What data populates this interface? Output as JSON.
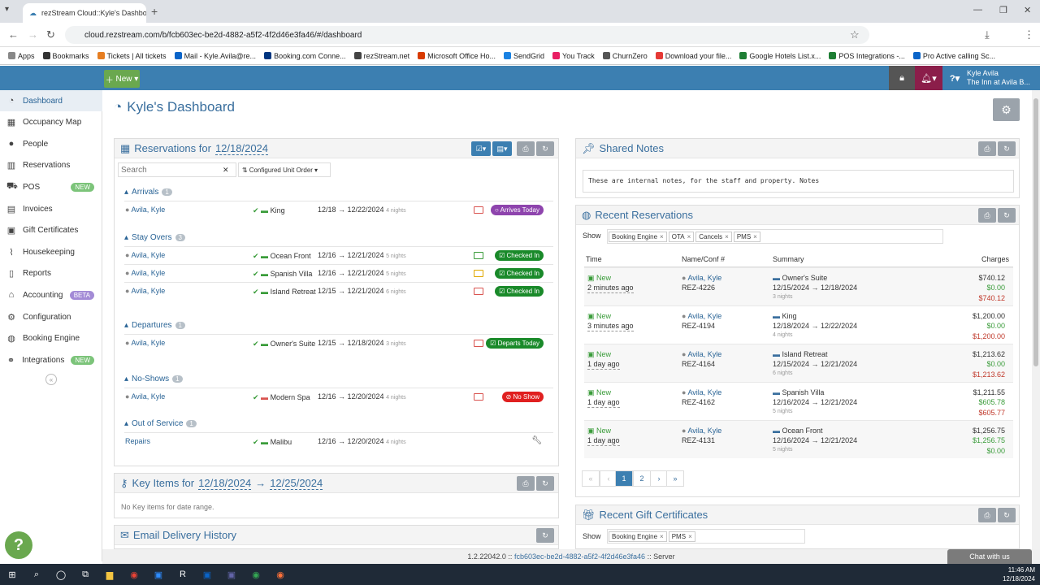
{
  "browser": {
    "tab_title": "rezStream Cloud::Kyle's Dashbo",
    "url": "cloud.rezstream.com/b/fcb603ec-be2d-4882-a5f2-4f2d46e3fa46/#/dashboard",
    "bookmarks": [
      "Apps",
      "Bookmarks",
      "Tickets | All tickets",
      "Mail - Kyle.Avila@re...",
      "Booking.com Conne...",
      "rezStream.net",
      "Microsoft Office Ho...",
      "SendGrid",
      "You Track",
      "ChurnZero",
      "Download your file...",
      "Google Hotels List.x...",
      "POS Integrations -...",
      "Pro Active calling Sc..."
    ]
  },
  "header": {
    "new_label": "New",
    "user_name": "Kyle Avila",
    "property": "The Inn at Avila B..."
  },
  "sidebar": {
    "items": [
      {
        "label": "Dashboard",
        "icon": "dashboard-icon"
      },
      {
        "label": "Occupancy Map",
        "icon": "calendar-icon"
      },
      {
        "label": "People",
        "icon": "user-icon"
      },
      {
        "label": "Reservations",
        "icon": "suitcase-icon"
      },
      {
        "label": "POS",
        "icon": "cart-icon",
        "badge": "NEW"
      },
      {
        "label": "Invoices",
        "icon": "grid-icon"
      },
      {
        "label": "Gift Certificates",
        "icon": "gift-icon"
      },
      {
        "label": "Housekeeping",
        "icon": "broom-icon"
      },
      {
        "label": "Reports",
        "icon": "chart-icon"
      },
      {
        "label": "Accounting",
        "icon": "bank-icon",
        "badge": "BETA"
      },
      {
        "label": "Configuration",
        "icon": "cogs-icon"
      },
      {
        "label": "Booking Engine",
        "icon": "globe-icon"
      },
      {
        "label": "Integrations",
        "icon": "handshake-icon",
        "badge": "NEW"
      }
    ]
  },
  "page": {
    "title": "Kyle's Dashboard"
  },
  "reservations": {
    "title_prefix": "Reservations for",
    "date": "12/18/2024",
    "search_placeholder": "Search",
    "order_label": "Configured Unit Order",
    "groups": [
      {
        "name": "Arrivals",
        "count": "1"
      },
      {
        "name": "Stay Overs",
        "count": "3"
      },
      {
        "name": "Departures",
        "count": "1"
      },
      {
        "name": "No-Shows",
        "count": "1"
      },
      {
        "name": "Out of Service",
        "count": "1"
      }
    ],
    "rows": [
      {
        "guest": "Avila, Kyle",
        "unit": "King",
        "dates": "12/18 → 12/22/2024",
        "nights": "4 nights",
        "status": "Arrives Today"
      },
      {
        "guest": "Avila, Kyle",
        "unit": "Ocean Front",
        "dates": "12/16 → 12/21/2024",
        "nights": "5 nights",
        "status": "Checked In"
      },
      {
        "guest": "Avila, Kyle",
        "unit": "Spanish Villa",
        "dates": "12/16 → 12/21/2024",
        "nights": "5 nights",
        "status": "Checked In"
      },
      {
        "guest": "Avila, Kyle",
        "unit": "Island Retreat",
        "dates": "12/15 → 12/21/2024",
        "nights": "6 nights",
        "status": "Checked In"
      },
      {
        "guest": "Avila, Kyle",
        "unit": "Owner's Suite",
        "dates": "12/15 → 12/18/2024",
        "nights": "3 nights",
        "status": "Departs Today"
      },
      {
        "guest": "Avila, Kyle",
        "unit": "Modern Spa",
        "dates": "12/16 → 12/20/2024",
        "nights": "4 nights",
        "status": "No Show"
      },
      {
        "guest": "Repairs",
        "unit": "Malibu",
        "dates": "12/16 → 12/20/2024",
        "nights": "4 nights",
        "status": ""
      }
    ]
  },
  "key_items": {
    "title_prefix": "Key Items for",
    "from": "12/18/2024",
    "to": "12/25/2024",
    "arrow": "→",
    "empty": "No Key items for date range."
  },
  "email": {
    "title": "Email Delivery History"
  },
  "notes": {
    "title": "Shared Notes",
    "text": "These are internal notes, for the staff and property. Notes"
  },
  "recent": {
    "title": "Recent Reservations",
    "show": "Show",
    "filters": [
      "Booking Engine",
      "OTA",
      "Cancels",
      "PMS"
    ],
    "columns": [
      "Time",
      "Name/Conf #",
      "Summary",
      "Charges"
    ],
    "rows": [
      {
        "status": "New",
        "time": "2 minutes ago",
        "name": "Avila, Kyle",
        "conf": "REZ-4226",
        "unit": "Owner's Suite",
        "dates": "12/15/2024 → 12/18/2024",
        "nights": "3 nights",
        "c1": "$740.12",
        "c2": "$0.00",
        "c3": "$740.12"
      },
      {
        "status": "New",
        "time": "3 minutes ago",
        "name": "Avila, Kyle",
        "conf": "REZ-4194",
        "unit": "King",
        "dates": "12/18/2024 → 12/22/2024",
        "nights": "4 nights",
        "c1": "$1,200.00",
        "c2": "$0.00",
        "c3": "$1,200.00"
      },
      {
        "status": "New",
        "time": "1 day ago",
        "name": "Avila, Kyle",
        "conf": "REZ-4164",
        "unit": "Island Retreat",
        "dates": "12/15/2024 → 12/21/2024",
        "nights": "6 nights",
        "c1": "$1,213.62",
        "c2": "$0.00",
        "c3": "$1,213.62"
      },
      {
        "status": "New",
        "time": "1 day ago",
        "name": "Avila, Kyle",
        "conf": "REZ-4162",
        "unit": "Spanish Villa",
        "dates": "12/16/2024 → 12/21/2024",
        "nights": "5 nights",
        "c1": "$1,211.55",
        "c2": "$605.78",
        "c3": "$605.77"
      },
      {
        "status": "New",
        "time": "1 day ago",
        "name": "Avila, Kyle",
        "conf": "REZ-4131",
        "unit": "Ocean Front",
        "dates": "12/16/2024 → 12/21/2024",
        "nights": "5 nights",
        "c1": "$1,256.75",
        "c2": "$1,256.75",
        "c3": "$0.00"
      }
    ],
    "pages": [
      "«",
      "‹",
      "1",
      "2",
      "›",
      "»"
    ]
  },
  "gift": {
    "title": "Recent Gift Certificates",
    "show": "Show",
    "filters": [
      "Booking Engine",
      "PMS"
    ]
  },
  "footer": {
    "version": "1.2.22042.0 ::",
    "id": "fcb603ec-be2d-4882-a5f2-4f2d46e3fa46",
    "suffix": ":: Server",
    "chat": "Chat with us"
  },
  "clock": {
    "time": "11:46 AM",
    "date": "12/18/2024"
  },
  "colors": {
    "accent": "#3c7fb1",
    "green": "#1a8a2a",
    "purple": "#8e44ad",
    "red": "#e02020"
  }
}
